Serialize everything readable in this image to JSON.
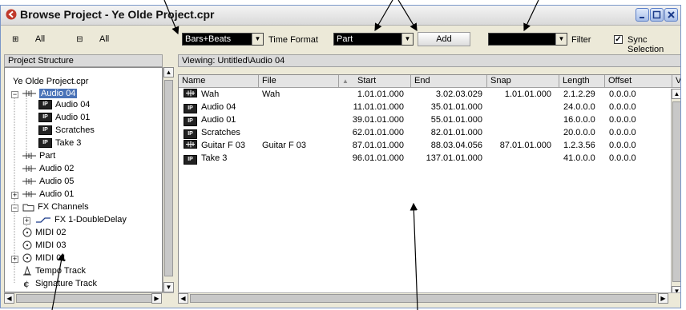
{
  "window": {
    "title": "Browse Project - Ye Olde Project.cpr"
  },
  "toolbar": {
    "expand_all": "All",
    "collapse_all": "All",
    "time_format_value": "Bars+Beats",
    "time_format_label": "Time Format",
    "type_value": "Part",
    "add_label": "Add",
    "filter_value": "",
    "filter_label": "Filter",
    "sync_label": "Sync Selection",
    "sync_checked": true
  },
  "left_panel": {
    "header": "Project Structure"
  },
  "tree": [
    {
      "label": "Ye Olde Project.cpr",
      "icon": "none"
    },
    {
      "label": "Audio 04",
      "icon": "audio-track-icon",
      "selected": true,
      "expanded": true
    },
    {
      "label": "Audio 04",
      "icon": "audio-part-icon"
    },
    {
      "label": "Audio 01",
      "icon": "audio-part-icon"
    },
    {
      "label": "Scratches",
      "icon": "audio-part-icon"
    },
    {
      "label": "Take 3",
      "icon": "audio-part-icon"
    },
    {
      "label": "Part",
      "icon": "audio-track-icon"
    },
    {
      "label": "Audio 02",
      "icon": "audio-track-icon"
    },
    {
      "label": "Audio 05",
      "icon": "audio-track-icon"
    },
    {
      "label": "Audio 01",
      "icon": "audio-track-icon",
      "collapsed": true
    },
    {
      "label": "FX Channels",
      "icon": "folder-icon",
      "expanded": true
    },
    {
      "label": "FX 1-DoubleDelay",
      "icon": "fx-channel-icon",
      "collapsed": true
    },
    {
      "label": "MIDI 02",
      "icon": "midi-track-icon"
    },
    {
      "label": "MIDI 03",
      "icon": "midi-track-icon"
    },
    {
      "label": "MIDI 01",
      "icon": "midi-track-icon",
      "collapsed": true
    },
    {
      "label": "Tempo Track",
      "icon": "tempo-track-icon"
    },
    {
      "label": "Signature Track",
      "icon": "signature-track-icon"
    }
  ],
  "right_panel": {
    "viewing": "Viewing: Untitled\\Audio 04"
  },
  "table": {
    "columns": [
      "Name",
      "File",
      "Start",
      "End",
      "Snap",
      "Length",
      "Offset",
      "V"
    ],
    "rows": [
      {
        "icon": "audio-event-icon",
        "name": "Wah",
        "file": "Wah",
        "start": "1.01.01.000",
        "end": "3.02.03.029",
        "snap": "1.01.01.000",
        "length": "2.1.2.29",
        "offset": "0.0.0.0"
      },
      {
        "icon": "audio-part-icon",
        "name": "Audio 04",
        "file": "",
        "start": "11.01.01.000",
        "end": "35.01.01.000",
        "snap": "",
        "length": "24.0.0.0",
        "offset": "0.0.0.0"
      },
      {
        "icon": "audio-part-icon",
        "name": "Audio 01",
        "file": "",
        "start": "39.01.01.000",
        "end": "55.01.01.000",
        "snap": "",
        "length": "16.0.0.0",
        "offset": "0.0.0.0"
      },
      {
        "icon": "audio-part-icon",
        "name": "Scratches",
        "file": "",
        "start": "62.01.01.000",
        "end": "82.01.01.000",
        "snap": "",
        "length": "20.0.0.0",
        "offset": "0.0.0.0"
      },
      {
        "icon": "audio-event-icon",
        "name": "Guitar F 03",
        "file": "Guitar F 03",
        "start": "87.01.01.000",
        "end": "88.03.04.056",
        "snap": "87.01.01.000",
        "length": "1.2.3.56",
        "offset": "0.0.0.0"
      },
      {
        "icon": "audio-part-icon",
        "name": "Take 3",
        "file": "",
        "start": "96.01.01.000",
        "end": "137.01.01.000",
        "snap": "",
        "length": "41.0.0.0",
        "offset": "0.0.0.0"
      }
    ]
  },
  "colors": {
    "selection": "#4a73b8",
    "window_bg": "#ece9d8",
    "title_gradient": "#d9d9d9"
  }
}
